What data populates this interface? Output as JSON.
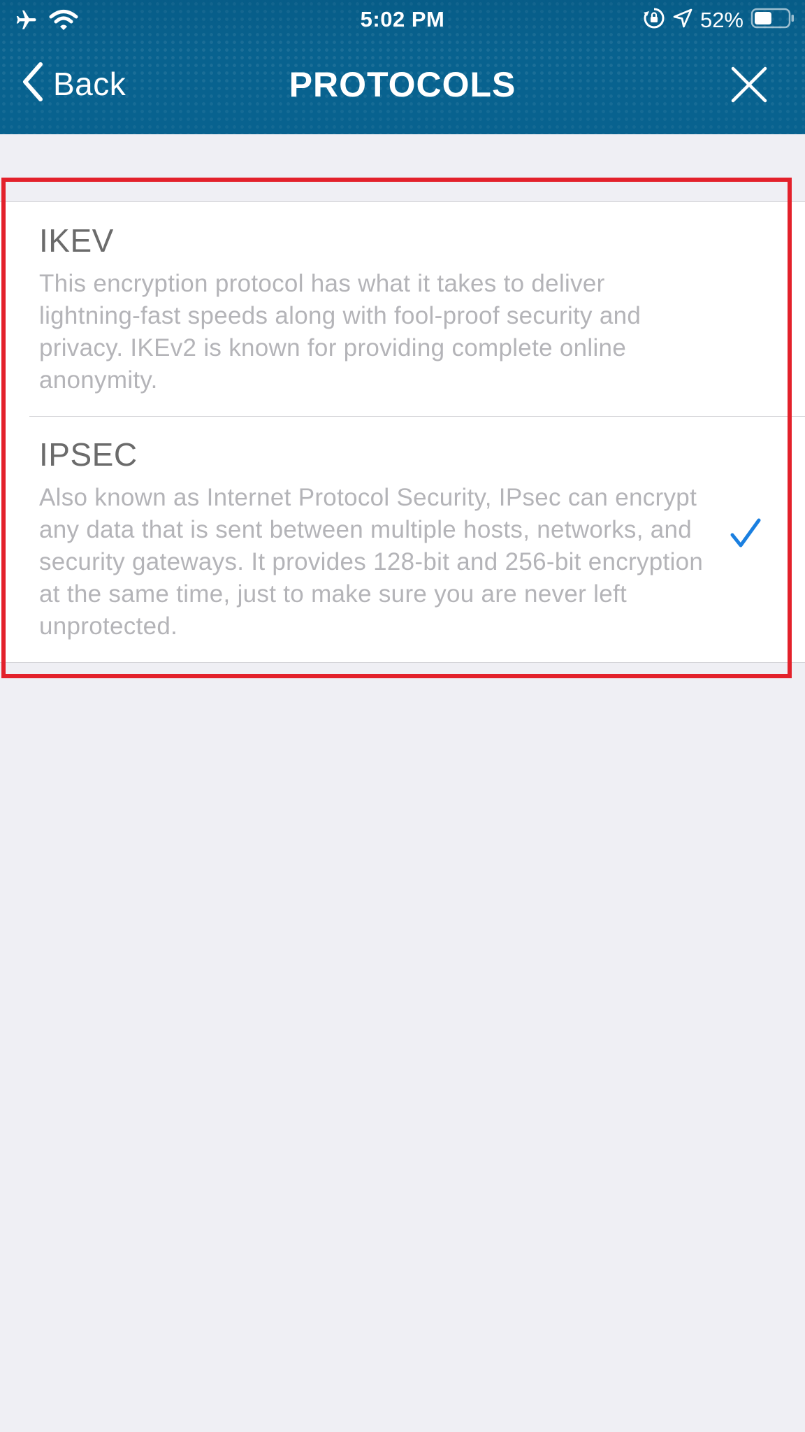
{
  "status_bar": {
    "time": "5:02 PM",
    "battery_percent": "52%",
    "battery_level": 0.52,
    "icons": [
      "airplane-icon",
      "wifi-icon",
      "orientation-lock-icon",
      "location-arrow-icon",
      "battery-icon"
    ]
  },
  "navbar": {
    "back_label": "Back",
    "title": "PROTOCOLS",
    "back_icon": "chevron-left-icon",
    "close_icon": "close-icon"
  },
  "protocols": [
    {
      "name": "IKEV",
      "description": "This encryption protocol has what it takes to deliver lightning-fast speeds along with fool-proof security and privacy. IKEv2 is known for providing complete online anonymity.",
      "selected": false
    },
    {
      "name": "IPSEC",
      "description": "Also known as Internet Protocol Security, IPsec can encrypt any data that is sent between multiple hosts, networks, and security gateways. It provides 128-bit and 256-bit encryption at the same time, just to make sure you are never left unprotected.",
      "selected": true
    }
  ],
  "colors": {
    "header_bg": "#08628f",
    "page_bg": "#efeff4",
    "checkmark": "#1a7fe0",
    "highlight_border": "#e3212b",
    "title_text": "#6b6b6b",
    "description_text": "#b4b4b8"
  }
}
